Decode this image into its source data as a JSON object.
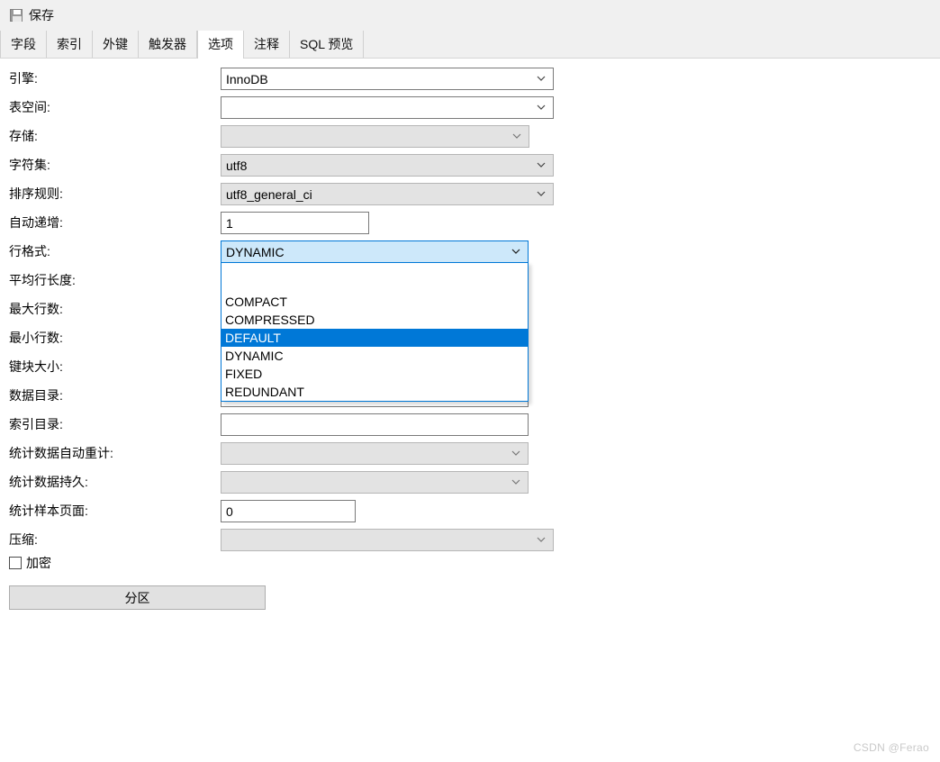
{
  "toolbar": {
    "save_label": "保存",
    "save_icon": "floppy-save-icon"
  },
  "tabs": [
    {
      "label": "字段",
      "active": false
    },
    {
      "label": "索引",
      "active": false
    },
    {
      "label": "外键",
      "active": false
    },
    {
      "label": "触发器",
      "active": false
    },
    {
      "label": "选项",
      "active": true
    },
    {
      "label": "注释",
      "active": false
    },
    {
      "label": "SQL 预览",
      "active": false
    }
  ],
  "fields": {
    "engine": {
      "label": "引擎:",
      "value": "InnoDB"
    },
    "tablespace": {
      "label": "表空间:",
      "value": ""
    },
    "storage": {
      "label": "存储:",
      "value": ""
    },
    "charset": {
      "label": "字符集:",
      "value": "utf8"
    },
    "collation": {
      "label": "排序规则:",
      "value": "utf8_general_ci"
    },
    "auto_increment": {
      "label": "自动递增:",
      "value": "1"
    },
    "row_format": {
      "label": "行格式:",
      "value": "DYNAMIC"
    },
    "avg_row_length": {
      "label": "平均行长度:",
      "value": ""
    },
    "max_rows": {
      "label": "最大行数:",
      "value": ""
    },
    "min_rows": {
      "label": "最小行数:",
      "value": ""
    },
    "key_block_size": {
      "label": "键块大小:",
      "value": ""
    },
    "data_directory": {
      "label": "数据目录:",
      "value": ""
    },
    "index_directory": {
      "label": "索引目录:",
      "value": ""
    },
    "stats_auto_recalc": {
      "label": "统计数据自动重计:",
      "value": ""
    },
    "stats_persistent": {
      "label": "统计数据持久:",
      "value": ""
    },
    "stats_sample_pages": {
      "label": "统计样本页面:",
      "value": "0"
    },
    "compression": {
      "label": "压缩:",
      "value": ""
    },
    "encryption": {
      "label": "加密",
      "checked": false
    }
  },
  "row_format_dropdown": {
    "open": true,
    "options": [
      "",
      "COMPACT",
      "COMPRESSED",
      "DEFAULT",
      "DYNAMIC",
      "FIXED",
      "REDUNDANT"
    ],
    "highlighted": "DEFAULT"
  },
  "buttons": {
    "partition": "分区"
  },
  "watermark": "CSDN @Ferao",
  "colors": {
    "accent": "#0078d7",
    "combo_focus_bg": "#cde8fa",
    "disabled_bg": "#e3e3e3",
    "toolbar_bg": "#f0f0f0",
    "watermark": "#c9c9c9"
  }
}
